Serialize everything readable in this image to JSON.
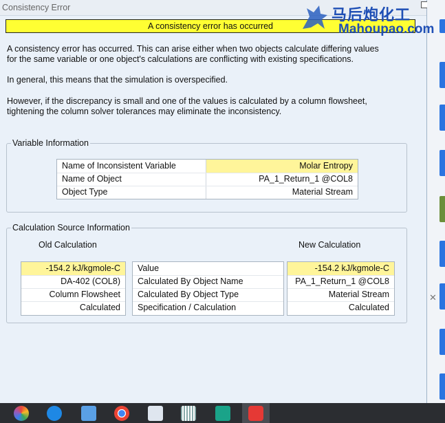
{
  "window": {
    "title": "Consistency Error"
  },
  "banner": "A consistency error has occurred",
  "paragraphs": {
    "p1_line1": "A consistency error has occurred.  This can arise either when two objects calculate differing values",
    "p1_line2": "for the same variable or one object's calculations are conflicting with existing specifications.",
    "p2": "In general, this means that the simulation is overspecified.",
    "p3_line1": "However, if the discrepancy is small and one of the values is calculated by a column flowsheet,",
    "p3_line2": "tightening the column solver tolerances may eliminate the inconsistency."
  },
  "variable_info": {
    "legend": "Variable Information",
    "rows": [
      {
        "label": "Name of Inconsistent Variable",
        "value": "Molar Entropy"
      },
      {
        "label": "Name of Object",
        "value": "PA_1_Return_1 @COL8"
      },
      {
        "label": "Object Type",
        "value": "Material Stream"
      }
    ]
  },
  "calc_source": {
    "legend": "Calculation Source Information",
    "old_heading": "Old Calculation",
    "new_heading": "New Calculation",
    "old_values": [
      "-154.2 kJ/kgmole-C",
      "DA-402 (COL8)",
      "Column Flowsheet",
      "Calculated"
    ],
    "labels": [
      "Value",
      "Calculated By Object Name",
      "Calculated By Object Type",
      "Specification / Calculation"
    ],
    "new_values": [
      "-154.2 kJ/kgmole-C",
      "PA_1_Return_1 @COL8",
      "Material Stream",
      "Calculated"
    ]
  },
  "watermark": {
    "chinese": "马后炮化工",
    "latin": "Mahoupao.com"
  },
  "taskbar": {
    "apps": [
      "photos-icon",
      "internet-explorer-icon",
      "database-icon",
      "chrome-icon",
      "document-icon",
      "grid-app-icon",
      "hysys-icon",
      "cloud-icon"
    ]
  }
}
